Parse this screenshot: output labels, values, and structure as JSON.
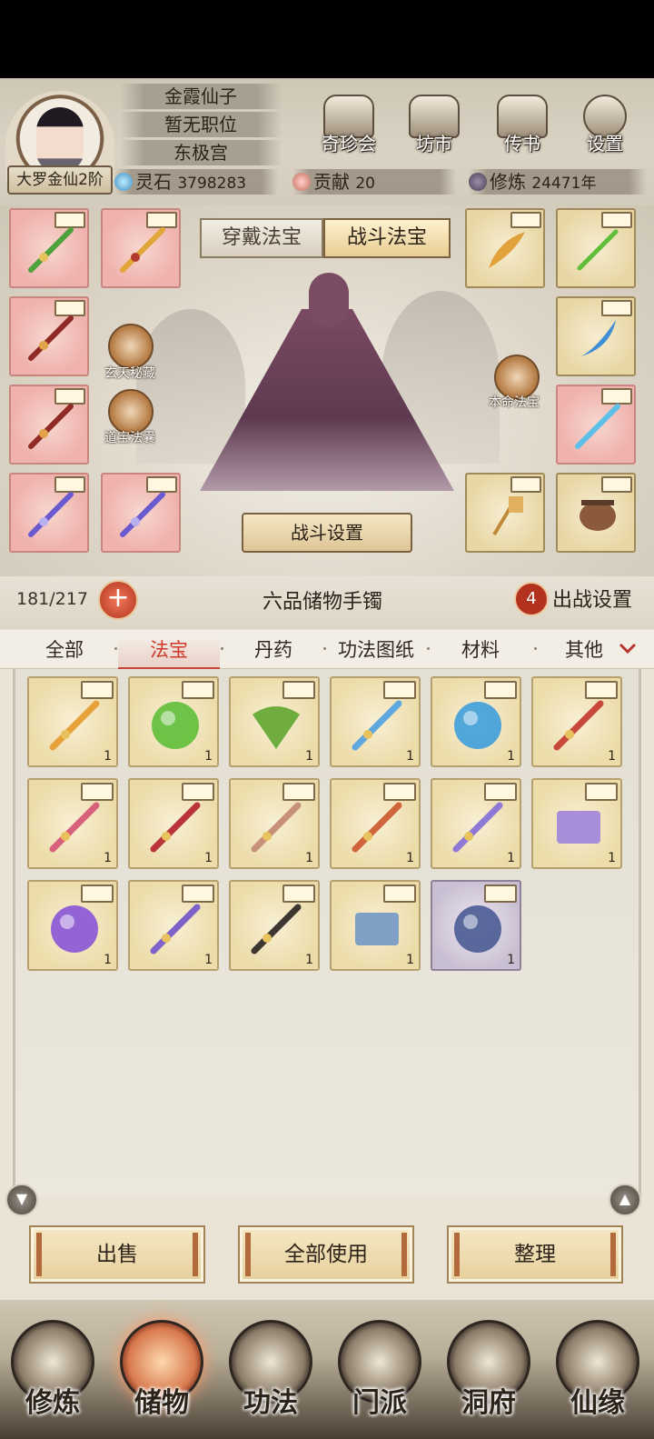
{
  "player": {
    "name": "金霞仙子",
    "position": "暂无职位",
    "sect": "东极宫",
    "realm": "大罗金仙2阶"
  },
  "top_menu": [
    {
      "label": "奇珍会",
      "icon": "pavilion-icon"
    },
    {
      "label": "坊市",
      "icon": "market-icon"
    },
    {
      "label": "传书",
      "icon": "scroll-icon"
    },
    {
      "label": "设置",
      "icon": "gear-icon"
    }
  ],
  "resources": {
    "spirit_stone_label": "灵石",
    "spirit_stone_value": "3798283",
    "contribution_label": "贡献",
    "contribution_value": "20",
    "cultivation_label": "修炼",
    "cultivation_value": "24471年"
  },
  "equip_tabs": [
    "穿戴法宝",
    "战斗法宝"
  ],
  "equip_active_tab": "战斗法宝",
  "side_buttons": {
    "mystic": "玄天秘藏",
    "treasure_bag": "道宝法囊",
    "natal": "本命法宝"
  },
  "battle_settings": "战斗设置",
  "capacity": "181/217",
  "bag_name": "六品储物手镯",
  "deploy_count": "4",
  "deploy_label": "出战设置",
  "categories": [
    "全部",
    "法宝",
    "丹药",
    "功法图纸",
    "材料",
    "其他"
  ],
  "active_category": "法宝",
  "inventory": [
    {
      "item": "golden-sword",
      "qty": "1",
      "color": "#e6a13b"
    },
    {
      "item": "green-orb",
      "qty": "1",
      "color": "#5fbf3a"
    },
    {
      "item": "leaf-fan",
      "qty": "1",
      "color": "#6fae3e"
    },
    {
      "item": "ice-sword",
      "qty": "1",
      "color": "#5ea7df"
    },
    {
      "item": "water-orb",
      "qty": "1",
      "color": "#3f9fdc"
    },
    {
      "item": "crimson-sword",
      "qty": "1",
      "color": "#c8483c"
    },
    {
      "item": "pink-ruyi",
      "qty": "1",
      "color": "#d9607a"
    },
    {
      "item": "red-dagger",
      "qty": "1",
      "color": "#b8343a"
    },
    {
      "item": "curved-horn",
      "qty": "1",
      "color": "#c69079"
    },
    {
      "item": "flame-blade",
      "qty": "1",
      "color": "#d0643a"
    },
    {
      "item": "violet-blade",
      "qty": "1",
      "color": "#8e79d6"
    },
    {
      "item": "purple-scroll",
      "qty": "1",
      "color": "#a88ed9"
    },
    {
      "item": "purple-orb",
      "qty": "1",
      "color": "#8a55d6"
    },
    {
      "item": "violet-sword",
      "qty": "1",
      "color": "#7d62c9"
    },
    {
      "item": "dark-staff",
      "qty": "1",
      "color": "#3d3631"
    },
    {
      "item": "blue-scroll",
      "qty": "1",
      "color": "#7f9fc4"
    },
    {
      "item": "pearl-orb",
      "qty": "1",
      "color": "#4a5b93",
      "rarity": "lavender"
    }
  ],
  "actions": {
    "sell": "出售",
    "use_all": "全部使用",
    "sort": "整理"
  },
  "nav": [
    {
      "label": "修炼"
    },
    {
      "label": "储物"
    },
    {
      "label": "功法"
    },
    {
      "label": "门派"
    },
    {
      "label": "洞府"
    },
    {
      "label": "仙缘"
    }
  ],
  "nav_active": "储物"
}
